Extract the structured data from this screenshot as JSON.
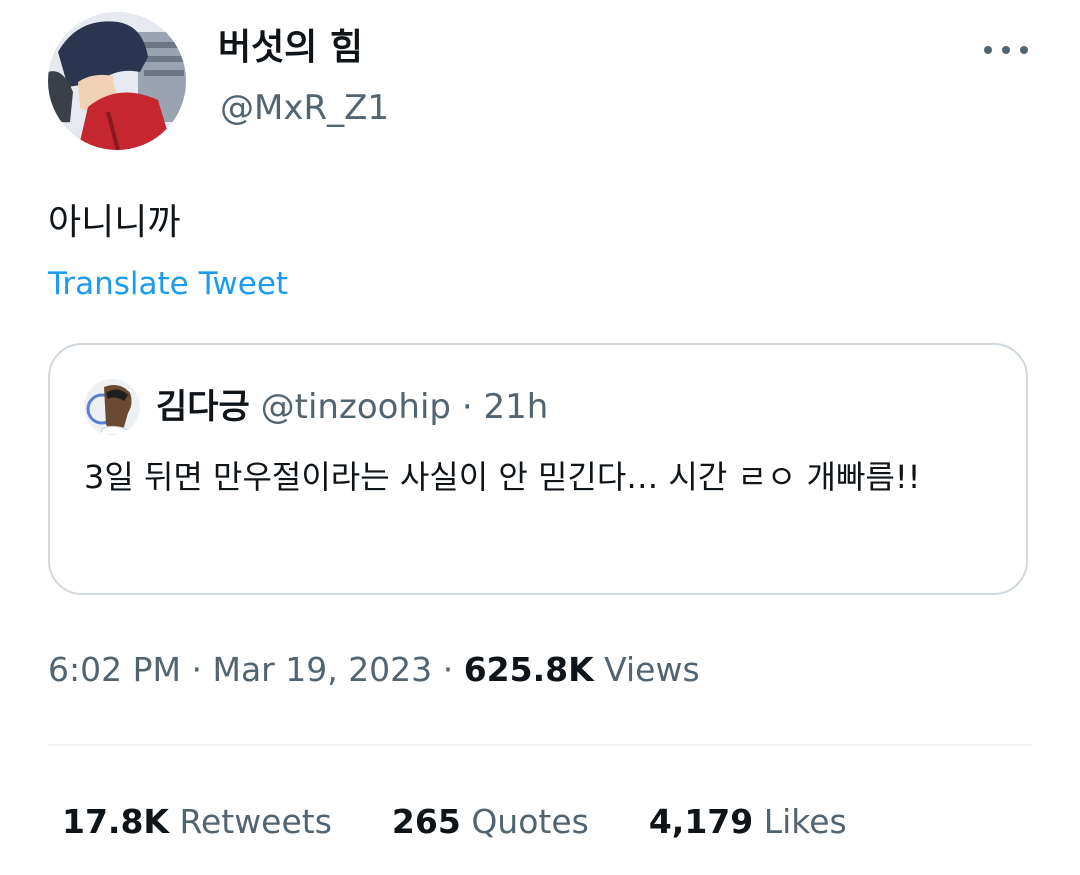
{
  "author": {
    "display_name": "버섯의 힘",
    "handle": "@MxR_Z1"
  },
  "tweet": {
    "text": "아니니까",
    "translate_label": "Translate Tweet"
  },
  "quoted_tweet": {
    "display_name": "김다긍",
    "handle": "@tinzoohip",
    "separator": "·",
    "time": "21h",
    "text": "3일 뒤면 만우절이라는 사실이 안 믿긴다… 시간 ㄹㅇ 개빠름!!"
  },
  "meta": {
    "time": "6:02 PM",
    "sep1": "·",
    "date": "Mar 19, 2023",
    "sep2": "·",
    "views_count": "625.8K",
    "views_label": "Views"
  },
  "stats": {
    "retweets_count": "17.8K",
    "retweets_label": "Retweets",
    "quotes_count": "265",
    "quotes_label": "Quotes",
    "likes_count": "4,179",
    "likes_label": "Likes"
  },
  "icons": {
    "more": "more-dots-icon"
  },
  "colors": {
    "link": "#1d9bf0",
    "secondary_text": "#536471",
    "border": "#cfd9de"
  }
}
